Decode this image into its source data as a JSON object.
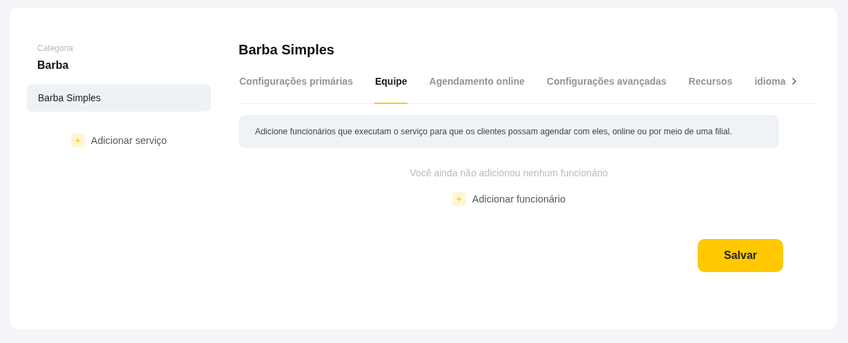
{
  "sidebar": {
    "category_label": "Categoria",
    "category": "Barba",
    "services": [
      {
        "label": "Barba Simples",
        "selected": true
      }
    ],
    "add_button": "Adicionar serviço"
  },
  "main": {
    "title": "Barba Simples",
    "tabs": [
      {
        "label": "Configurações primárias",
        "selected": false
      },
      {
        "label": "Equipe",
        "selected": true
      },
      {
        "label": "Agendamento online",
        "selected": false
      },
      {
        "label": "Configurações avançadas",
        "selected": false
      },
      {
        "label": "Recursos",
        "selected": false
      },
      {
        "label": "idioma",
        "selected": false
      }
    ],
    "info": "Adicione funcionários que executam o serviço para que os clientes possam agendar com eles, online ou por meio de uma filial.",
    "empty_message": "Você ainda não adicionou nenhum funcionário",
    "add_button": "Adicionar funcionário",
    "save_button": "Salvar"
  }
}
